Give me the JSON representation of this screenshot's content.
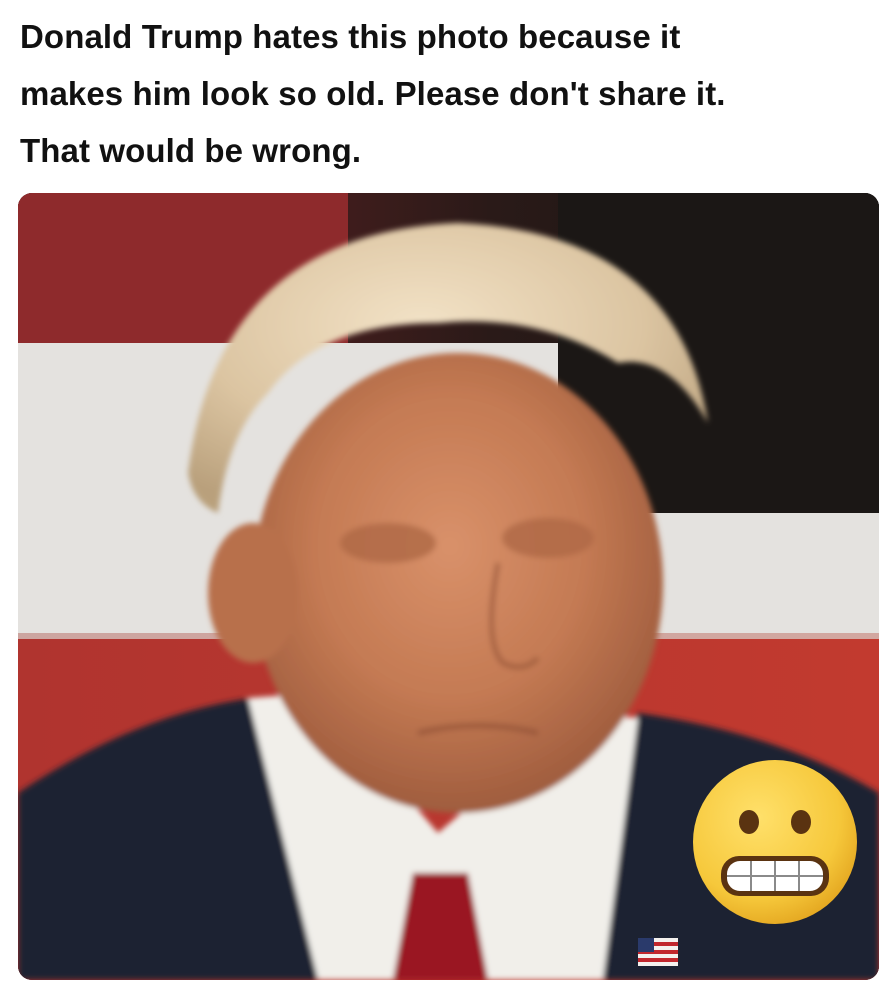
{
  "post": {
    "caption_lines": [
      "Donald Trump hates this photo because it",
      "makes him look so old. Please don't share it.",
      "That would be wrong."
    ]
  },
  "photo": {
    "emoji": "grimacing-face-emoji",
    "flag_pin": "american-flag-pin-icon",
    "colors": {
      "background_red": "#8e2a2c",
      "background_white": "#e4e2df",
      "background_dark": "#1b1715",
      "suit": "#1d2233",
      "shirt": "#f1efea",
      "tie": "#9a1822",
      "emoji_yellow": "#f6c83b"
    }
  }
}
